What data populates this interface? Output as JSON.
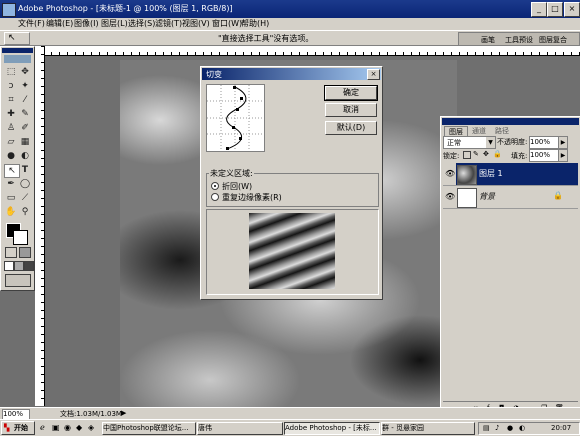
{
  "window": {
    "title": "Adobe Photoshop - [未标题-1 @ 100% (图层 1, RGB/8)]",
    "controls": [
      "_",
      "□",
      "×"
    ]
  },
  "menubar": {
    "items": [
      "文件(F)",
      "编辑(E)",
      "图像(I)",
      "图层(L)",
      "选择(S)",
      "滤镜(T)",
      "视图(V)",
      "窗口(W)",
      "帮助(H)"
    ]
  },
  "options_bar": {
    "message": "\"直接选择工具\"没有选项。",
    "palette_well_tabs": [
      "画笔",
      "工具预设",
      "图层复合"
    ]
  },
  "dialog": {
    "title": "切变",
    "close": "×",
    "ok_label": "确定",
    "cancel_label": "取消",
    "default_label": "默认(D)",
    "undefined_area_label": "未定义区域:",
    "option_wrap": "折回(W)",
    "option_repeat": "重复边缘像素(R)",
    "selected_option": "折回(W)"
  },
  "layers_panel": {
    "tabs": [
      "图层",
      "通道",
      "路径"
    ],
    "blend_mode": "正常",
    "opacity_label": "不透明度:",
    "opacity_value": "100%",
    "lock_label": "锁定:",
    "fill_label": "填充:",
    "fill_value": "100%",
    "layers": [
      {
        "name": "图层 1",
        "selected": true
      },
      {
        "name": "背景",
        "selected": false,
        "locked": true
      }
    ]
  },
  "status_bar": {
    "zoom": "100%",
    "doc_info": "文档:1.03M/1.03M"
  },
  "taskbar": {
    "start_label": "开始",
    "tasks": [
      "中国Photoshop联盟论坛...",
      "唐伟",
      "Adobe Photoshop - [未标...",
      "群 - 觅悬家园"
    ],
    "clock": "20:07"
  },
  "colors": {
    "titlebar": "#0b2576",
    "chrome": "#d4d0c8",
    "selection": "#0a246a",
    "workspace": "#6f6f6f"
  }
}
